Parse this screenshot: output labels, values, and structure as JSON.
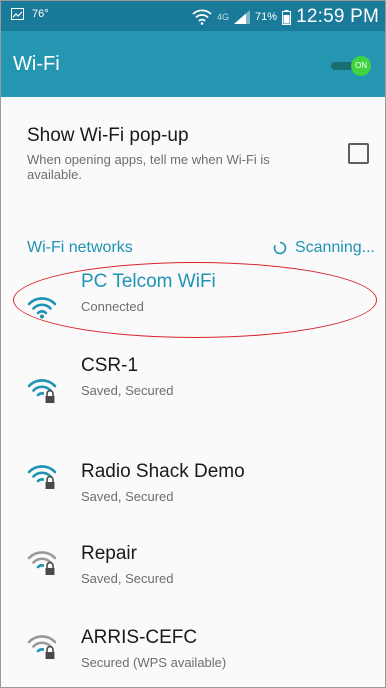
{
  "statusbar": {
    "temperature": "76°",
    "network_type": "4G",
    "battery": "71%",
    "time": "12:59 PM"
  },
  "header": {
    "title": "Wi-Fi",
    "toggle_label": "ON"
  },
  "popup_setting": {
    "title": "Show Wi-Fi pop-up",
    "description": "When opening apps, tell me when Wi-Fi is available.",
    "checked": false
  },
  "networks_section": {
    "title": "Wi-Fi networks",
    "scanning_label": "Scanning..."
  },
  "networks": [
    {
      "name": "PC Telcom WiFi",
      "status": "Connected",
      "secured": false
    },
    {
      "name": "CSR-1",
      "status": "Saved, Secured",
      "secured": true
    },
    {
      "name": "Radio Shack Demo",
      "status": "Saved, Secured",
      "secured": true
    },
    {
      "name": "Repair",
      "status": "Saved, Secured",
      "secured": true
    },
    {
      "name": "ARRIS-CEFC",
      "status": "Secured (WPS available)",
      "secured": true
    }
  ],
  "colors": {
    "status_bar": "#1a7a9a",
    "app_bar": "#2596b2",
    "accent": "#1f93b4",
    "toggle_on": "#3fd33f",
    "highlight": "#d8232a",
    "signal_strong": "#1f93b4",
    "signal_weak": "#9a9a9a"
  }
}
